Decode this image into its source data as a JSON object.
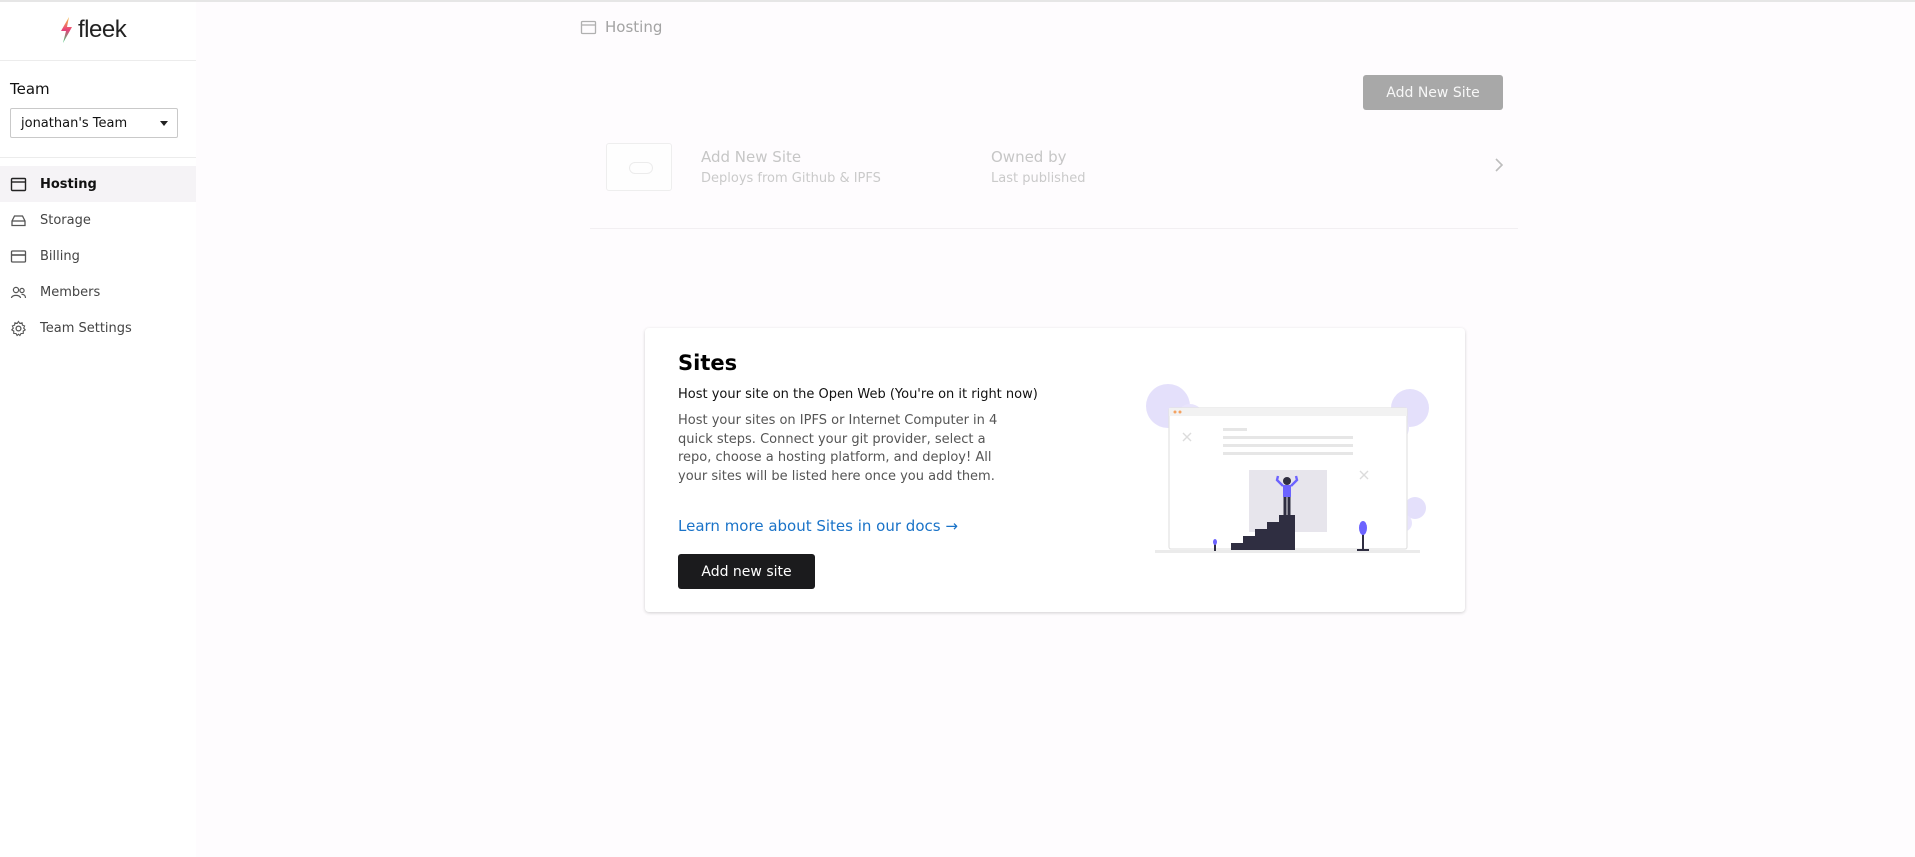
{
  "brand": {
    "name": "fleek"
  },
  "sidebar": {
    "team_label": "Team",
    "team_select": {
      "value": "jonathan's Team"
    },
    "items": [
      {
        "label": "Hosting",
        "icon": "browser-icon",
        "active": true
      },
      {
        "label": "Storage",
        "icon": "drive-icon",
        "active": false
      },
      {
        "label": "Billing",
        "icon": "credit-card-icon",
        "active": false
      },
      {
        "label": "Members",
        "icon": "users-icon",
        "active": false
      },
      {
        "label": "Team Settings",
        "icon": "gear-icon",
        "active": false
      }
    ]
  },
  "breadcrumb": {
    "label": "Hosting",
    "icon": "browser-icon"
  },
  "header": {
    "add_button_label": "Add New Site"
  },
  "placeholder_row": {
    "title": "Add New Site",
    "subtitle": "Deploys from Github & IPFS",
    "owner_label": "Owned by",
    "published_label": "Last published"
  },
  "empty_state": {
    "title": "Sites",
    "subtitle": "Host your site on the Open Web (You're on it right now)",
    "description": "Host your sites on IPFS or Internet Computer in 4 quick steps. Connect your git provider, select a repo, choose a hosting platform, and deploy! All your sites will be listed here once you add them.",
    "link_text": "Learn more about Sites in our docs →",
    "button_label": "Add new site"
  },
  "colors": {
    "accent_link": "#1a73c8",
    "primary_button": "#1b1b1d",
    "disabled_button": "#a8a8a8",
    "illustration_purple": "#6c63ff"
  }
}
